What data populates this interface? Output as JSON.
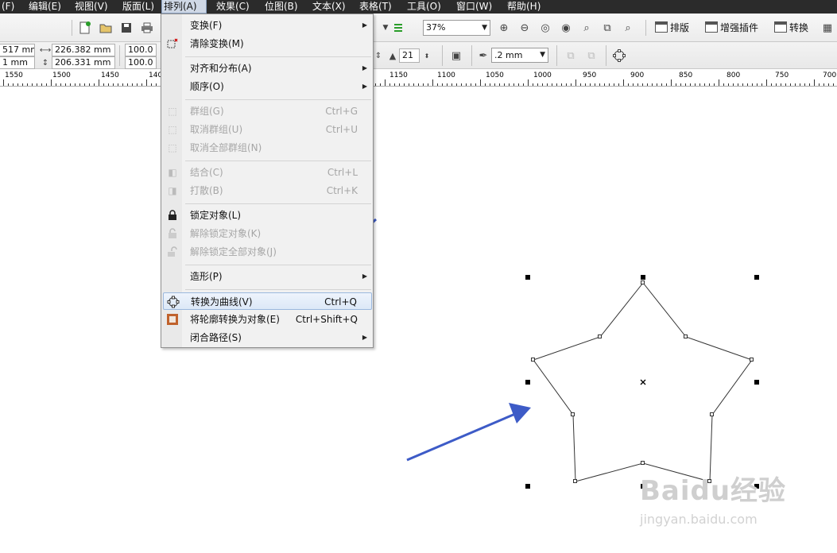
{
  "menubar": {
    "items": [
      "(F)",
      "编辑(E)",
      "视图(V)",
      "版面(L)",
      "排列(A)",
      "效果(C)",
      "位图(B)",
      "文本(X)",
      "表格(T)",
      "工具(O)",
      "窗口(W)",
      "帮助(H)"
    ],
    "active": "排列(A)"
  },
  "toolbar": {
    "zoom": "37%",
    "buttons": [
      "排版",
      "增强插件",
      "转换"
    ]
  },
  "property_bar": {
    "x_value": "517 mm",
    "y_value": "1 mm",
    "width_value": "226.382 mm",
    "height_value": "206.331 mm",
    "scale_x": "100.0",
    "scale_y": "100.0",
    "points_value": "21",
    "outline_width": ".2 mm"
  },
  "ruler": {
    "labels": [
      "1550",
      "1500",
      "1450",
      "140",
      "1150",
      "1100",
      "1050",
      "1000",
      "950",
      "900",
      "850",
      "800",
      "750",
      "700"
    ]
  },
  "menu": {
    "items": [
      {
        "label": "变换(F)",
        "shortcut": "",
        "submenu": true,
        "disabled": false,
        "icon": ""
      },
      {
        "label": "清除变换(M)",
        "shortcut": "",
        "submenu": false,
        "disabled": false,
        "icon": "clear-transform-icon"
      },
      {
        "label": "对齐和分布(A)",
        "shortcut": "",
        "submenu": true,
        "disabled": false,
        "icon": ""
      },
      {
        "label": "顺序(O)",
        "shortcut": "",
        "submenu": true,
        "disabled": false,
        "icon": ""
      },
      {
        "label": "群组(G)",
        "shortcut": "Ctrl+G",
        "submenu": false,
        "disabled": true,
        "icon": "group-icon"
      },
      {
        "label": "取消群组(U)",
        "shortcut": "Ctrl+U",
        "submenu": false,
        "disabled": true,
        "icon": "ungroup-icon"
      },
      {
        "label": "取消全部群组(N)",
        "shortcut": "",
        "submenu": false,
        "disabled": true,
        "icon": "ungroup-all-icon"
      },
      {
        "label": "结合(C)",
        "shortcut": "Ctrl+L",
        "submenu": false,
        "disabled": true,
        "icon": "combine-icon"
      },
      {
        "label": "打散(B)",
        "shortcut": "Ctrl+K",
        "submenu": false,
        "disabled": true,
        "icon": "break-apart-icon"
      },
      {
        "label": "锁定对象(L)",
        "shortcut": "",
        "submenu": false,
        "disabled": false,
        "icon": "lock-icon"
      },
      {
        "label": "解除锁定对象(K)",
        "shortcut": "",
        "submenu": false,
        "disabled": true,
        "icon": "unlock-icon"
      },
      {
        "label": "解除锁定全部对象(J)",
        "shortcut": "",
        "submenu": false,
        "disabled": true,
        "icon": "unlock-all-icon"
      },
      {
        "label": "造形(P)",
        "shortcut": "",
        "submenu": true,
        "disabled": false,
        "icon": ""
      },
      {
        "label": "转换为曲线(V)",
        "shortcut": "Ctrl+Q",
        "submenu": false,
        "disabled": false,
        "icon": "convert-to-curves-icon",
        "highlighted": true
      },
      {
        "label": "将轮廓转换为对象(E)",
        "shortcut": "Ctrl+Shift+Q",
        "submenu": false,
        "disabled": false,
        "icon": "outline-to-object-icon"
      },
      {
        "label": "闭合路径(S)",
        "shortcut": "",
        "submenu": true,
        "disabled": false,
        "icon": ""
      }
    ]
  },
  "watermark": {
    "brand": "Baidu经验",
    "url": "jingyan.baidu.com"
  },
  "colors": {
    "arrow": "#3d5bc7",
    "highlight": "#dce8f7",
    "menubar": "#2b2b2b"
  }
}
